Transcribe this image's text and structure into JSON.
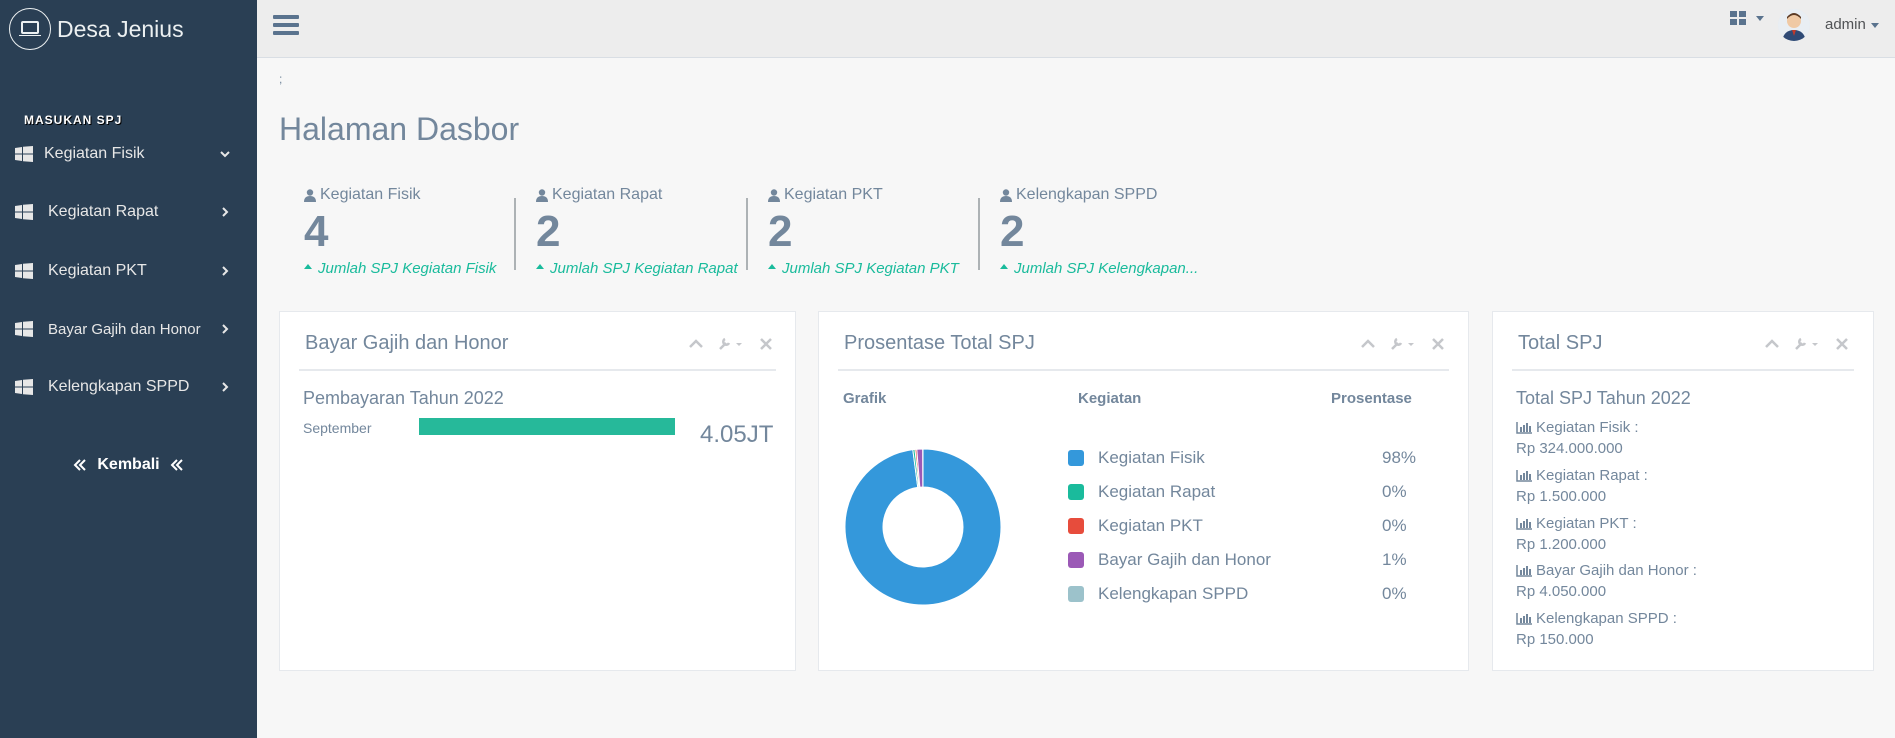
{
  "app": {
    "title": "Desa Jenius",
    "icon": "laptop-icon"
  },
  "sidebar": {
    "section": "MASUKAN SPJ",
    "items": [
      {
        "label": "Kegiatan Fisik",
        "icon": "windows-icon",
        "chevron": "down"
      },
      {
        "label": "Kegiatan Rapat",
        "icon": "windows-icon",
        "chevron": "right"
      },
      {
        "label": "Kegiatan PKT",
        "icon": "windows-icon",
        "chevron": "right"
      },
      {
        "label": "Bayar Gajih dan Honor",
        "icon": "windows-icon",
        "chevron": "right"
      },
      {
        "label": "Kelengkapan SPPD",
        "icon": "windows-icon",
        "chevron": "right"
      }
    ],
    "back_label": "Kembali"
  },
  "topbar": {
    "user": "admin",
    "apps_icon": "grid-icon"
  },
  "breadcrumb": ";",
  "page_title": "Halaman Dasbor",
  "tiles": [
    {
      "label": "Kegiatan Fisik",
      "count": "4",
      "bottom": "Jumlah SPJ Kegiatan Fisik"
    },
    {
      "label": "Kegiatan Rapat",
      "count": "2",
      "bottom": "Jumlah SPJ Kegiatan Rapat"
    },
    {
      "label": "Kegiatan PKT",
      "count": "2",
      "bottom": "Jumlah SPJ Kegiatan PKT"
    },
    {
      "label": "Kelengkapan SPPD",
      "count": "2",
      "bottom": "Jumlah SPJ Kelengkapan..."
    }
  ],
  "panel_gaji": {
    "title": "Bayar Gajih dan Honor",
    "subtitle": "Pembayaran Tahun 2022",
    "bars": [
      {
        "label": "September",
        "value_text": "4.05JT",
        "fill": 1.0
      }
    ]
  },
  "panel_prosentase": {
    "title": "Prosentase Total SPJ",
    "col_grafik": "Grafik",
    "col_kegiatan": "Kegiatan",
    "col_prosentase": "Prosentase",
    "rows": [
      {
        "label": "Kegiatan Fisik",
        "pct": "98%",
        "color": "#3498db"
      },
      {
        "label": "Kegiatan Rapat",
        "pct": "0%",
        "color": "#1abb9c"
      },
      {
        "label": "Kegiatan PKT",
        "pct": "0%",
        "color": "#e74c3c"
      },
      {
        "label": "Bayar Gajih dan Honor",
        "pct": "1%",
        "color": "#9b59b6"
      },
      {
        "label": "Kelengkapan SPPD",
        "pct": "0%",
        "color": "#9cc2cb"
      }
    ]
  },
  "chart_data": {
    "type": "pie",
    "categories": [
      "Kegiatan Fisik",
      "Kegiatan Rapat",
      "Kegiatan PKT",
      "Bayar Gajih dan Honor",
      "Kelengkapan SPPD"
    ],
    "values": [
      324000000,
      1500000,
      1200000,
      4050000,
      150000
    ],
    "colors": [
      "#3498db",
      "#1abb9c",
      "#e74c3c",
      "#9b59b6",
      "#9cc2cb"
    ],
    "donut": true
  },
  "panel_total": {
    "title": "Total SPJ",
    "subtitle": "Total SPJ Tahun 2022",
    "items": [
      {
        "label": "Kegiatan Fisik :",
        "value": "Rp 324.000.000"
      },
      {
        "label": "Kegiatan Rapat :",
        "value": "Rp 1.500.000"
      },
      {
        "label": "Kegiatan PKT :",
        "value": "Rp 1.200.000"
      },
      {
        "label": "Bayar Gajih dan Honor :",
        "value": "Rp 4.050.000"
      },
      {
        "label": "Kelengkapan SPPD :",
        "value": "Rp 150.000"
      }
    ]
  }
}
